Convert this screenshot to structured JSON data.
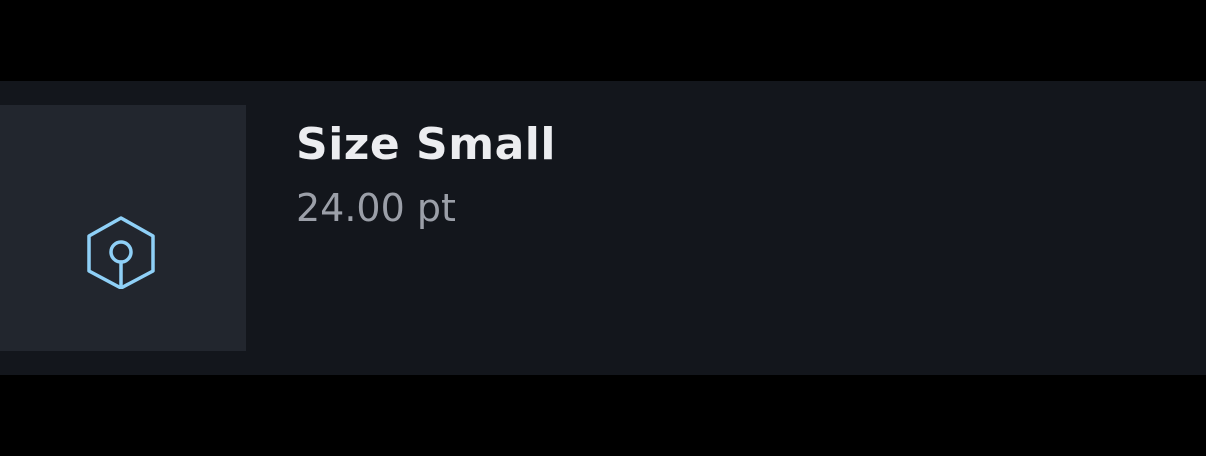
{
  "item": {
    "title": "Size Small",
    "value": "24.00 pt",
    "icon": "cube-icon"
  },
  "colors": {
    "page_background": "#000000",
    "card_background": "#13161c",
    "thumbnail_background": "#22262e",
    "icon_color": "#8fd0f7",
    "title_color": "#ecedf0",
    "subtitle_color": "#9b9fa8"
  }
}
